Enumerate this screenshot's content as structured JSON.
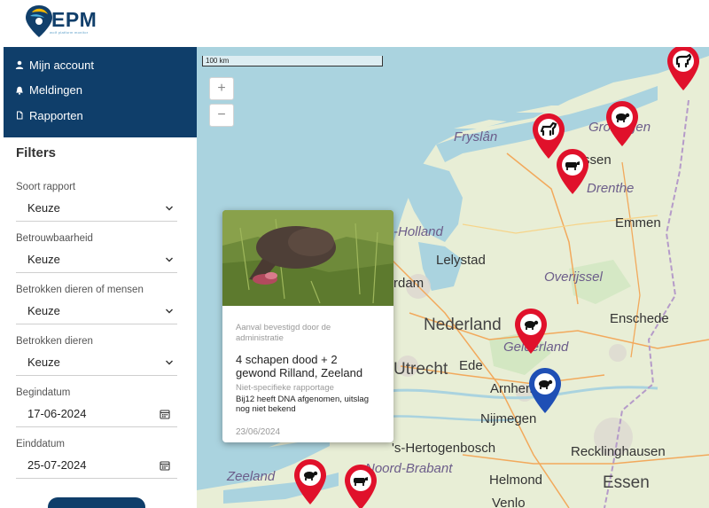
{
  "logo": {
    "text": "EPM",
    "tagline": "wolf platform monitor"
  },
  "nav": {
    "account_label": "Mijn account",
    "notifications_label": "Meldingen",
    "reports_label": "Rapporten"
  },
  "filters": {
    "title": "Filters",
    "report_type": {
      "label": "Soort rapport",
      "value": "Keuze"
    },
    "reliability": {
      "label": "Betrouwbaarheid",
      "value": "Keuze"
    },
    "involved_animals_people": {
      "label": "Betrokken dieren of mensen",
      "value": "Keuze"
    },
    "involved_animals": {
      "label": "Betrokken dieren",
      "value": "Keuze"
    },
    "start_date": {
      "label": "Begindatum",
      "value": "17-06-2024"
    },
    "end_date": {
      "label": "Einddatum",
      "value": "25-07-2024"
    }
  },
  "map": {
    "scale_label": "100 km",
    "zoom_in": "+",
    "zoom_out": "−",
    "labels": {
      "frysland": "Fryslân",
      "groningen": "Groningen",
      "drenthe": "Drenthe",
      "noord_holland": "-Holland",
      "overijssel": "Overijssel",
      "gelderland": "Gelderland",
      "noord_brabant": "Noord-Brabant",
      "zeeland": "Zeeland"
    },
    "cities": {
      "assen": "Assen",
      "emmen": "Emmen",
      "lelystad": "Lelystad",
      "amsterdam": "rdam",
      "nederland": "Nederland",
      "enschede": "Enschede",
      "utrecht": "Utrecht",
      "ede": "Ede",
      "arnhem": "Arnhem",
      "nijmegen": "Nijmegen",
      "hertogenbosch": "'s-Hertogenbosch",
      "recklinghausen": "Recklinghausen",
      "helmond": "Helmond",
      "essen": "Essen",
      "venlo": "Venlo"
    },
    "pin_colors": {
      "confirmed": "#e0112b",
      "selected": "#1f4fb5"
    }
  },
  "popup": {
    "status": "Aanval bevestigd door de administratie",
    "title": "4 schapen dood + 2 gewond Rilland, Zeeland",
    "type": "Niet-specifieke rapportage",
    "description": "Bij12 heeft DNA afgenomen, uitslag nog niet bekend",
    "date": "23/06/2024"
  }
}
